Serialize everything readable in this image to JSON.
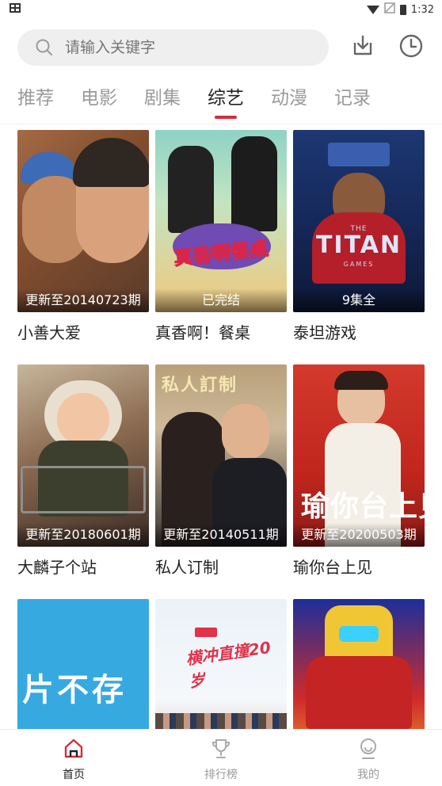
{
  "status_bar": {
    "left_icon": "bug-icon",
    "time": "1:32"
  },
  "search": {
    "placeholder": "请输入关键字"
  },
  "header_actions": [
    {
      "icon": "download-icon"
    },
    {
      "icon": "history-clock-icon"
    }
  ],
  "tabs": [
    {
      "label": "推荐",
      "active": false
    },
    {
      "label": "电影",
      "active": false
    },
    {
      "label": "剧集",
      "active": false
    },
    {
      "label": "综艺",
      "active": true
    },
    {
      "label": "动漫",
      "active": false
    },
    {
      "label": "记录",
      "active": false
    }
  ],
  "cards": [
    {
      "title": "小善大爱",
      "caption": "更新至20140723期"
    },
    {
      "title": "真香啊！餐桌",
      "caption": "已完结",
      "poster_text": "真香啊餐桌"
    },
    {
      "title": "泰坦游戏",
      "caption": "9集全",
      "poster_text": "TITAN",
      "poster_subtext": "GAMES",
      "poster_kicker": "THE"
    },
    {
      "title": "大麟子个站",
      "caption": "更新至20180601期"
    },
    {
      "title": "私人订制",
      "caption": "更新至20140511期",
      "poster_text": "私人訂制"
    },
    {
      "title": "瑜你台上见",
      "caption": "更新至20200503期",
      "poster_text": "瑜你台上见"
    },
    {
      "title": "",
      "caption": "",
      "poster_text": "片不存"
    },
    {
      "title": "",
      "caption": "",
      "poster_text": "横冲直撞20岁"
    },
    {
      "title": "",
      "caption": ""
    }
  ],
  "bottom_nav": [
    {
      "label": "首页",
      "icon": "home-icon",
      "active": true
    },
    {
      "label": "排行榜",
      "icon": "trophy-icon",
      "active": false
    },
    {
      "label": "我的",
      "icon": "profile-icon",
      "active": false
    }
  ],
  "colors": {
    "accent": "#d62d3d",
    "tab_inactive": "#9a9a9a",
    "search_bg": "#efefef"
  }
}
